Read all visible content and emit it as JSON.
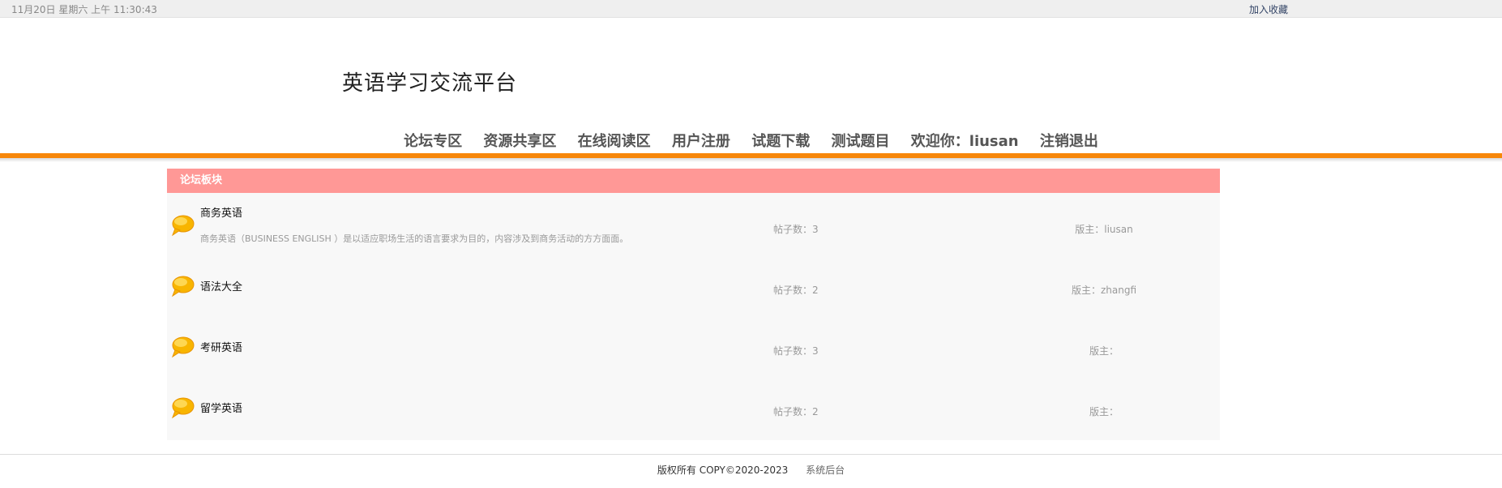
{
  "topbar": {
    "datetime": "11月20日 星期六 上午 11:30:43",
    "bookmark": "加入收藏"
  },
  "site_title": "英语学习交流平台",
  "nav": {
    "items": [
      "论坛专区",
      "资源共享区",
      "在线阅读区",
      "用户注册",
      "试题下载",
      "测试题目",
      "欢迎你：liusan",
      "注销退出"
    ]
  },
  "board": {
    "header": "论坛板块",
    "rows": [
      {
        "name": "商务英语",
        "desc": "商务英语（BUSINESS ENGLISH ）是以适应职场生活的语言要求为目的，内容涉及到商务活动的方方面面。",
        "posts": "帖子数：3",
        "moderator": "版主：liusan"
      },
      {
        "name": "语法大全",
        "desc": "",
        "posts": "帖子数：2",
        "moderator": "版主：zhangfi"
      },
      {
        "name": "考研英语",
        "desc": "",
        "posts": "帖子数：3",
        "moderator": "版主："
      },
      {
        "name": "留学英语",
        "desc": "",
        "posts": "帖子数：2",
        "moderator": "版主："
      }
    ]
  },
  "footer": {
    "copyright": "版权所有 COPY©2020-2023",
    "admin_link": "系统后台"
  },
  "colors": {
    "accent_orange": "#f7870a",
    "header_pink": "#ff9896",
    "bubble_yellow": "#f8b500"
  }
}
